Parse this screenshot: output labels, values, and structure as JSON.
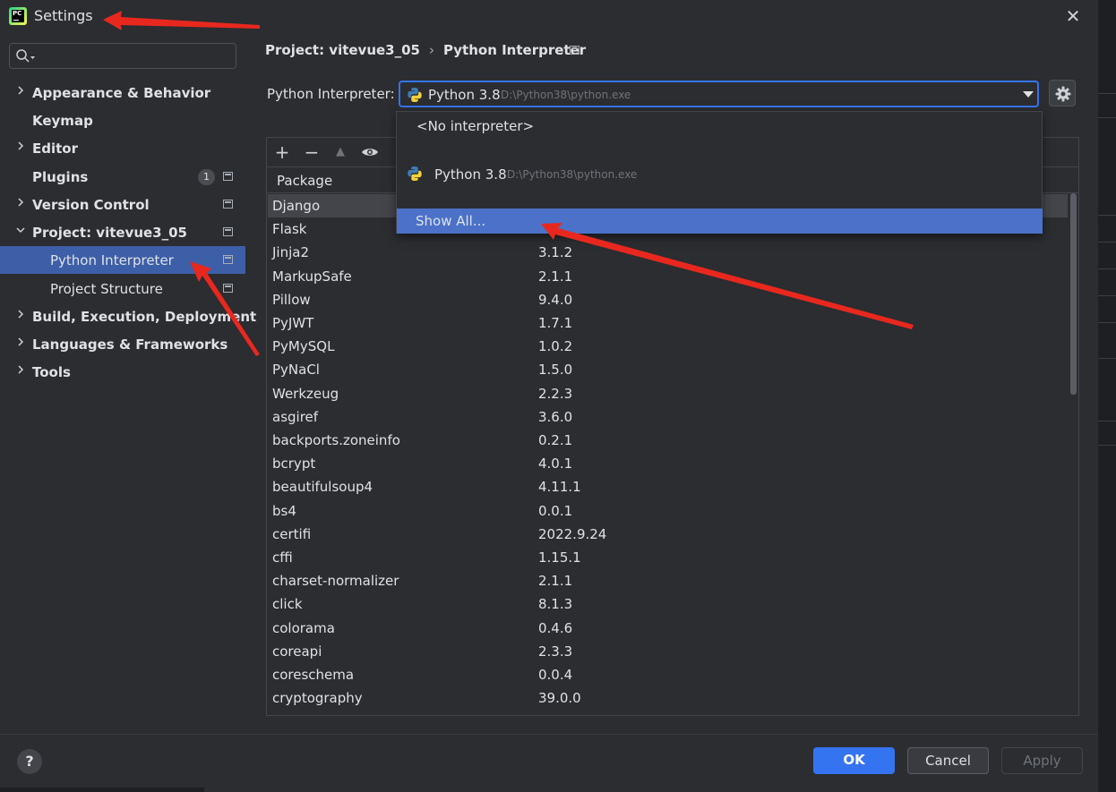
{
  "window": {
    "title": "Settings",
    "app_icon": "pycharm-icon",
    "close_symbol": "✕"
  },
  "search": {
    "placeholder": "",
    "icon": "search-icon"
  },
  "sidebar": {
    "items": [
      {
        "label": "Appearance & Behavior",
        "expandable": true,
        "expanded": false
      },
      {
        "label": "Keymap",
        "expandable": false
      },
      {
        "label": "Editor",
        "expandable": true,
        "expanded": false
      },
      {
        "label": "Plugins",
        "expandable": false,
        "badge": "1"
      },
      {
        "label": "Version Control",
        "expandable": true,
        "expanded": false
      },
      {
        "label": "Project: vitevue3_05",
        "expandable": true,
        "expanded": true
      },
      {
        "label": "Python Interpreter",
        "sub": true,
        "selected": true
      },
      {
        "label": "Project Structure",
        "sub": true
      },
      {
        "label": "Build, Execution, Deployment",
        "expandable": true,
        "expanded": false
      },
      {
        "label": "Languages & Frameworks",
        "expandable": true,
        "expanded": false
      },
      {
        "label": "Tools",
        "expandable": true,
        "expanded": false
      }
    ]
  },
  "breadcrumb": {
    "project": "Project: vitevue3_05",
    "separator": "›",
    "page": "Python Interpreter"
  },
  "interpreter": {
    "label": "Python Interpreter:",
    "selected_name": "Python 3.8",
    "selected_path": "D:\\Python38\\python.exe"
  },
  "dropdown": {
    "options": [
      {
        "label": "<No interpreter>"
      },
      {
        "name": "Python 3.8",
        "path": "D:\\Python38\\python.exe"
      },
      {
        "label": "Show All..."
      }
    ],
    "highlighted": "Show All..."
  },
  "packages": {
    "toolbar": {
      "add": "+",
      "remove": "−",
      "upgrade": "▲",
      "show": "eye-icon"
    },
    "header": {
      "package": "Package"
    },
    "rows": [
      {
        "name": "Django",
        "version": ""
      },
      {
        "name": "Flask",
        "version": ""
      },
      {
        "name": "Jinja2",
        "version": "3.1.2"
      },
      {
        "name": "MarkupSafe",
        "version": "2.1.1"
      },
      {
        "name": "Pillow",
        "version": "9.4.0"
      },
      {
        "name": "PyJWT",
        "version": "1.7.1"
      },
      {
        "name": "PyMySQL",
        "version": "1.0.2"
      },
      {
        "name": "PyNaCl",
        "version": "1.5.0"
      },
      {
        "name": "Werkzeug",
        "version": "2.2.3"
      },
      {
        "name": "asgiref",
        "version": "3.6.0"
      },
      {
        "name": "backports.zoneinfo",
        "version": "0.2.1"
      },
      {
        "name": "bcrypt",
        "version": "4.0.1"
      },
      {
        "name": "beautifulsoup4",
        "version": "4.11.1"
      },
      {
        "name": "bs4",
        "version": "0.0.1"
      },
      {
        "name": "certifi",
        "version": "2022.9.24"
      },
      {
        "name": "cffi",
        "version": "1.15.1"
      },
      {
        "name": "charset-normalizer",
        "version": "2.1.1"
      },
      {
        "name": "click",
        "version": "8.1.3"
      },
      {
        "name": "colorama",
        "version": "0.4.6"
      },
      {
        "name": "coreapi",
        "version": "2.3.3"
      },
      {
        "name": "coreschema",
        "version": "0.0.4"
      },
      {
        "name": "cryptography",
        "version": "39.0.0"
      }
    ]
  },
  "footer": {
    "help": "?",
    "ok": "OK",
    "cancel": "Cancel",
    "apply": "Apply"
  },
  "colors": {
    "accent": "#3574f0",
    "selection": "#4b72c8",
    "annotation": "#e8281e",
    "background": "#2b2d30"
  }
}
